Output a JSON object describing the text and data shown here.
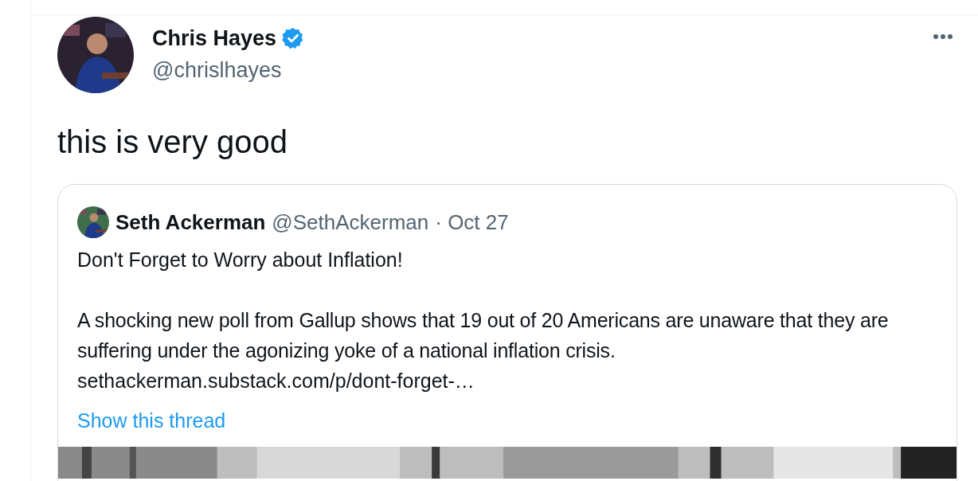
{
  "tweet": {
    "author": {
      "name": "Chris Hayes",
      "verified": true,
      "handle": "@chrislhayes"
    },
    "text": "this is very good",
    "quoted": {
      "author": {
        "name": "Seth Ackerman",
        "handle": "@SethAckerman",
        "date": "· Oct 27"
      },
      "title": "Don't Forget to Worry about Inflation!",
      "body": "A shocking new poll from Gallup shows that 19 out of 20 Americans are unaware that they are suffering under the agonizing yoke of a national inflation crisis.",
      "link": "sethackerman.substack.com/p/dont-forget-…",
      "show_thread": "Show this thread"
    }
  }
}
